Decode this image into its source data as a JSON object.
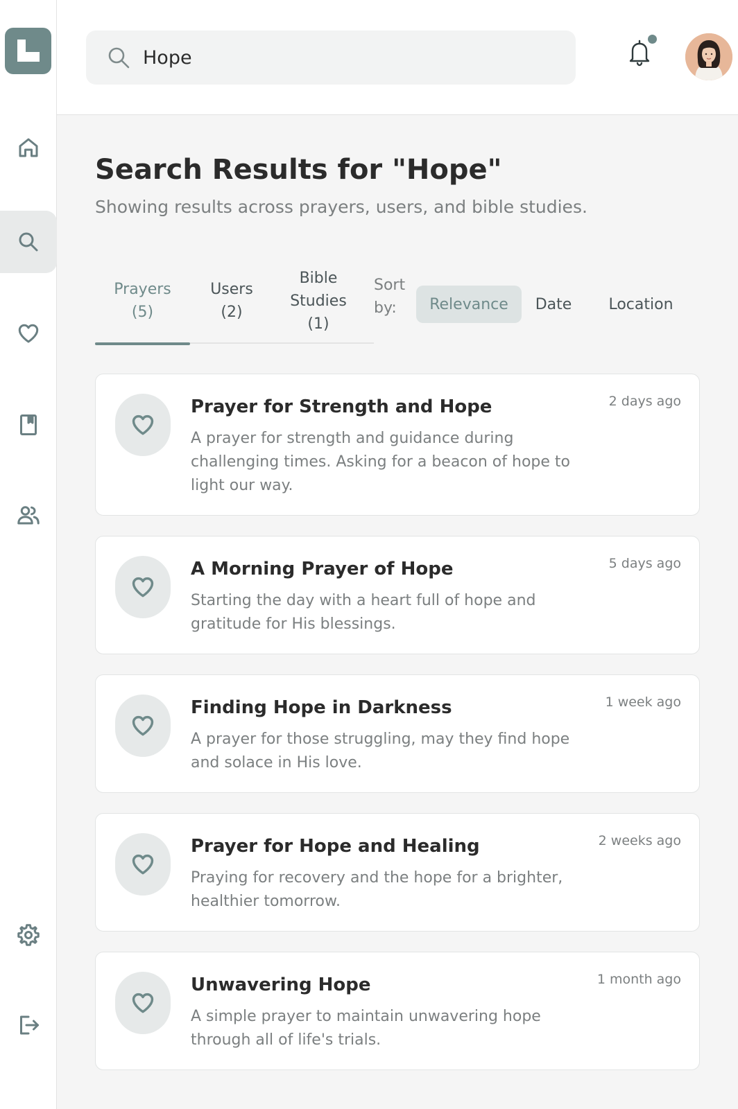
{
  "search": {
    "value": "Hope"
  },
  "sidebar": {
    "items": [
      {
        "name": "home",
        "icon": "home-icon"
      },
      {
        "name": "search",
        "icon": "search-icon"
      },
      {
        "name": "favorites",
        "icon": "heart-icon"
      },
      {
        "name": "bible",
        "icon": "book-icon"
      },
      {
        "name": "community",
        "icon": "users-icon"
      },
      {
        "name": "settings",
        "icon": "gear-icon"
      },
      {
        "name": "logout",
        "icon": "logout-icon"
      }
    ]
  },
  "header": {
    "notification_dot": true
  },
  "page": {
    "title": "Search Results for \"Hope\"",
    "subtitle": "Showing results across prayers, users, and bible studies."
  },
  "tabs": [
    {
      "line1": "Prayers",
      "line2": "(5)",
      "line3": ""
    },
    {
      "line1": "Users",
      "line2": "(2)",
      "line3": ""
    },
    {
      "line1": "Bible",
      "line2": "Studies",
      "line3": "(1)"
    }
  ],
  "sort": {
    "label_line1": "Sort",
    "label_line2": "by:",
    "options": [
      "Relevance",
      "Date",
      "Location"
    ]
  },
  "results": [
    {
      "title": "Prayer for Strength and Hope",
      "description": "A prayer for strength and guidance during challenging times. Asking for a beacon of hope to light our way.",
      "time": "2 days ago"
    },
    {
      "title": "A Morning Prayer of Hope",
      "description": "Starting the day with a heart full of hope and gratitude for His blessings.",
      "time": "5 days ago"
    },
    {
      "title": "Finding Hope in Darkness",
      "description": "A prayer for those struggling, may they find hope and solace in His love.",
      "time": "1 week ago"
    },
    {
      "title": "Prayer for Hope and Healing",
      "description": "Praying for recovery and the hope for a brighter, healthier tomorrow.",
      "time": "2 weeks ago"
    },
    {
      "title": "Unwavering Hope",
      "description": "A simple prayer to maintain unwavering hope through all of life's trials.",
      "time": "1 month ago"
    }
  ],
  "colors": {
    "accent": "#6f8a8a",
    "muted_text": "#7b7f80",
    "background": "#f5f5f5"
  }
}
